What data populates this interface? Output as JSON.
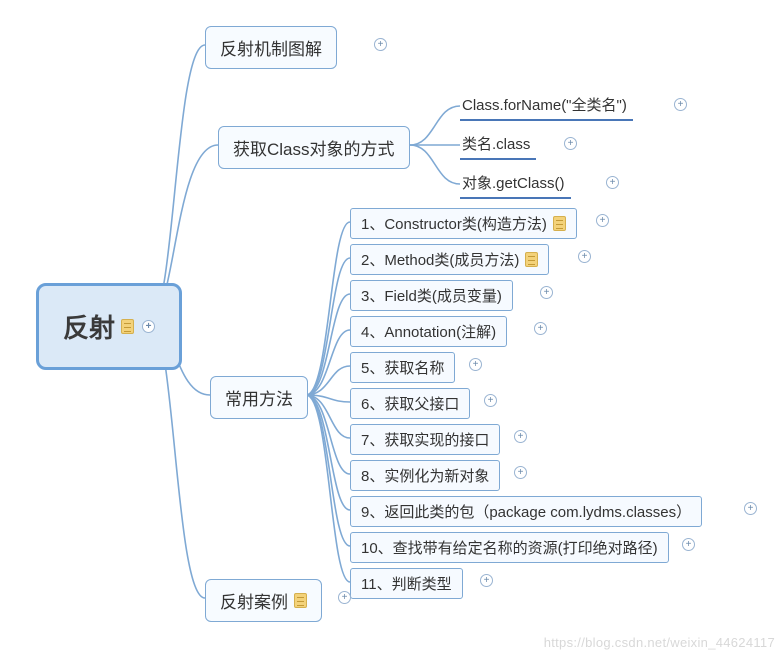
{
  "root": {
    "label": "反射"
  },
  "branches": [
    {
      "label": "反射机制图解",
      "has_note": false,
      "has_expand": true
    },
    {
      "label": "获取Class对象的方式",
      "has_note": false,
      "has_expand": false
    },
    {
      "label": "常用方法",
      "has_note": false,
      "has_expand": false
    },
    {
      "label": "反射案例",
      "has_note": true,
      "has_expand": true
    }
  ],
  "class_ways": [
    {
      "label": "Class.forName(\"全类名\")",
      "has_expand": true
    },
    {
      "label": "类名.class",
      "has_expand": true
    },
    {
      "label": "对象.getClass()",
      "has_expand": true
    }
  ],
  "methods": [
    {
      "label": "1、Constructor类(构造方法)",
      "has_note": true,
      "has_expand": true
    },
    {
      "label": "2、Method类(成员方法)",
      "has_note": true,
      "has_expand": true
    },
    {
      "label": "3、Field类(成员变量)",
      "has_note": false,
      "has_expand": true
    },
    {
      "label": "4、Annotation(注解)",
      "has_note": false,
      "has_expand": true
    },
    {
      "label": "5、获取名称",
      "has_note": false,
      "has_expand": true
    },
    {
      "label": "6、获取父接口",
      "has_note": false,
      "has_expand": true
    },
    {
      "label": "7、获取实现的接口",
      "has_note": false,
      "has_expand": true
    },
    {
      "label": "8、实例化为新对象",
      "has_note": false,
      "has_expand": true
    },
    {
      "label": "9、返回此类的包（package com.lydms.classes）",
      "has_note": false,
      "has_expand": true
    },
    {
      "label": "10、查找带有给定名称的资源(打印绝对路径)",
      "has_note": false,
      "has_expand": true
    },
    {
      "label": "11、判断类型",
      "has_note": false,
      "has_expand": true
    }
  ],
  "watermark": "https://blog.csdn.net/weixin_44624117",
  "chart_data": {
    "type": "tree",
    "title": "反射",
    "root": "反射",
    "children": [
      {
        "name": "反射机制图解"
      },
      {
        "name": "获取Class对象的方式",
        "children": [
          {
            "name": "Class.forName(\"全类名\")"
          },
          {
            "name": "类名.class"
          },
          {
            "name": "对象.getClass()"
          }
        ]
      },
      {
        "name": "常用方法",
        "children": [
          {
            "name": "1、Constructor类(构造方法)"
          },
          {
            "name": "2、Method类(成员方法)"
          },
          {
            "name": "3、Field类(成员变量)"
          },
          {
            "name": "4、Annotation(注解)"
          },
          {
            "name": "5、获取名称"
          },
          {
            "name": "6、获取父接口"
          },
          {
            "name": "7、获取实现的接口"
          },
          {
            "name": "8、实例化为新对象"
          },
          {
            "name": "9、返回此类的包（package com.lydms.classes）"
          },
          {
            "name": "10、查找带有给定名称的资源(打印绝对路径)"
          },
          {
            "name": "11、判断类型"
          }
        ]
      },
      {
        "name": "反射案例"
      }
    ]
  }
}
